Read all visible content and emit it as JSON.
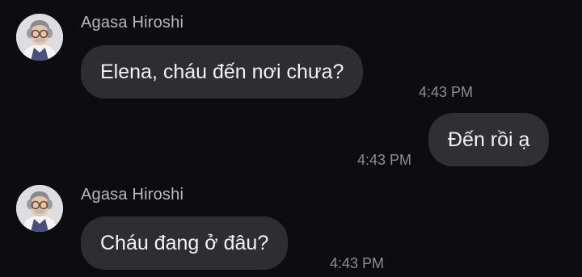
{
  "messages": [
    {
      "direction": "incoming",
      "sender": "Agasa Hiroshi",
      "text": "Elena, cháu đến nơi chưa?",
      "time": "4:43 PM",
      "avatar_icon": "agasa-avatar-icon"
    },
    {
      "direction": "outgoing",
      "text": "Đến rồi ạ",
      "time": "4:43 PM"
    },
    {
      "direction": "incoming",
      "sender": "Agasa Hiroshi",
      "text": "Cháu đang ở đâu?",
      "time": "4:43 PM",
      "avatar_icon": "agasa-avatar-icon"
    }
  ],
  "colors": {
    "background": "#0d0d0f",
    "bubble": "#2e2e31",
    "text": "#f2f2f4",
    "sender": "#b9b9bd",
    "time": "#8c8c91"
  }
}
